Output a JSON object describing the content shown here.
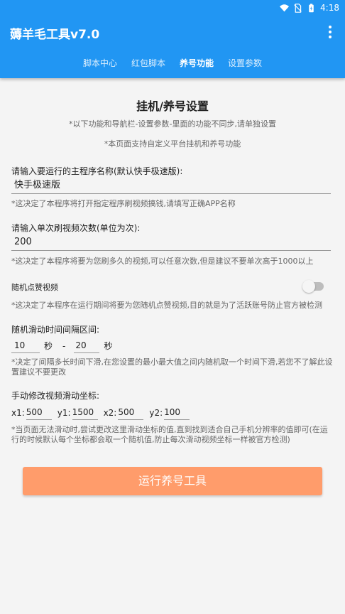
{
  "status": {
    "time": "4:18"
  },
  "app": {
    "title": "薅羊毛工具v7.0"
  },
  "tabs": [
    {
      "label": "脚本中心"
    },
    {
      "label": "红包脚本"
    },
    {
      "label": "养号功能"
    },
    {
      "label": "设置参数"
    }
  ],
  "page": {
    "heading": "挂机/养号设置",
    "note1": "*以下功能和导航栏-设置参数-里面的功能不同步,请单独设置",
    "note2": "*本页面支持自定义平台挂机和养号功能"
  },
  "app_name": {
    "label": "请输入要运行的主程序名称(默认快手极速版):",
    "value": "快手极速版",
    "hint": "*这决定了本程序将打开指定程序刷视频搞钱,请填写正确APP名称"
  },
  "watch_count": {
    "label": "请输入单次刷视频次数(单位为次):",
    "value": "200",
    "hint": "*这决定了本程序将要为您刷多久的视频,可以任意次数,但是建议不要单次高于1000以上"
  },
  "random_like": {
    "label": "随机点赞视频",
    "enabled": false,
    "hint": "*这决定了本程序在运行期间将要为您随机点赞视频,目的就是为了活跃账号防止官方被检测"
  },
  "swipe_interval": {
    "label": "随机滑动时间间隔区间:",
    "min": "10",
    "max": "20",
    "unit": "秒",
    "separator": "-",
    "hint": "*决定了间隔多长时间下滑,在您设置的最小最大值之间内随机取一个时间下滑,若您不了解此设置建议不要更改"
  },
  "swipe_coords": {
    "label": "手动修改视频滑动坐标:",
    "x1_label": "x1:",
    "x1": "500",
    "y1_label": "y1:",
    "y1": "1500",
    "x2_label": "x2:",
    "x2": "500",
    "y2_label": "y2:",
    "y2": "100",
    "hint": "*当页面无法滑动时,尝试更改这里滑动坐标的值,直到找到适合自己手机分辨率的值即可(在运行的时候默认每个坐标都会取一个随机值,防止每次滑动视频坐标一样被官方检测)"
  },
  "run_button": "运行养号工具",
  "colors": {
    "primary": "#2196f3",
    "button": "#ff9c6b"
  }
}
